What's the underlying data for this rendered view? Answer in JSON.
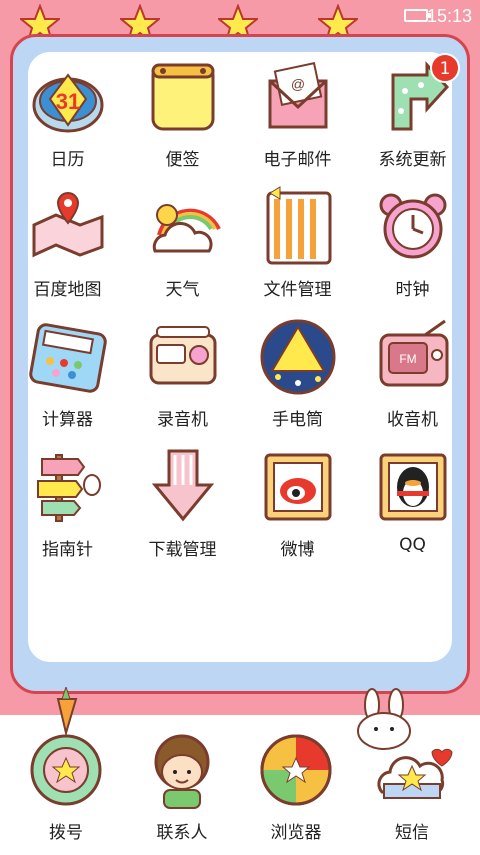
{
  "status": {
    "time": "15:13"
  },
  "apps": [
    {
      "label": "日历",
      "icon": "calendar-icon"
    },
    {
      "label": "便签",
      "icon": "notepad-icon"
    },
    {
      "label": "电子邮件",
      "icon": "email-icon"
    },
    {
      "label": "系统更新",
      "icon": "update-arrow-icon",
      "badge": "1"
    },
    {
      "label": "百度地图",
      "icon": "map-icon"
    },
    {
      "label": "天气",
      "icon": "weather-icon"
    },
    {
      "label": "文件管理",
      "icon": "folder-icon"
    },
    {
      "label": "时钟",
      "icon": "alarm-clock-icon"
    },
    {
      "label": "计算器",
      "icon": "calculator-icon"
    },
    {
      "label": "录音机",
      "icon": "recorder-icon"
    },
    {
      "label": "手电筒",
      "icon": "flashlight-icon"
    },
    {
      "label": "收音机",
      "icon": "radio-icon"
    },
    {
      "label": "指南针",
      "icon": "compass-signpost-icon"
    },
    {
      "label": "下载管理",
      "icon": "download-arrow-icon"
    },
    {
      "label": "微博",
      "icon": "weibo-icon"
    },
    {
      "label": "QQ",
      "icon": "qq-penguin-icon"
    }
  ],
  "dock": [
    {
      "label": "拨号",
      "icon": "dialer-flower-icon"
    },
    {
      "label": "联系人",
      "icon": "contacts-doll-icon"
    },
    {
      "label": "浏览器",
      "icon": "browser-ball-icon"
    },
    {
      "label": "短信",
      "icon": "sms-cloud-icon"
    }
  ],
  "calendar_day": "31",
  "colors": {
    "frame": "#d6454f",
    "pink_bg": "#f59aa6",
    "blue_border": "#bcd6f4",
    "badge": "#e83a2c"
  }
}
